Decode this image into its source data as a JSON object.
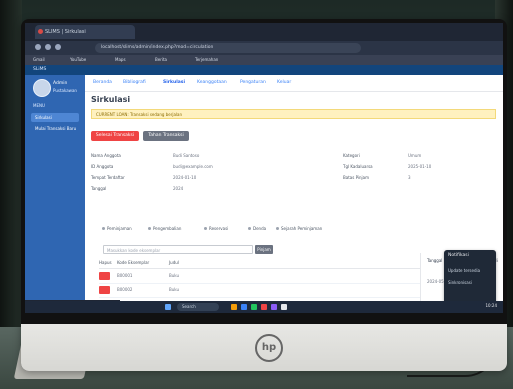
{
  "browser": {
    "tab_title": "SLIMS | Sirkulasi",
    "address": "localhost/slims/admin/index.php?mod=circulation",
    "bookmarks": [
      "Gmail",
      "YouTube",
      "Maps",
      "Berita",
      "Terjemahan"
    ]
  },
  "topbar": {
    "text": "SLiMS"
  },
  "sidebar": {
    "profile_name": "Admin",
    "profile_role": "Pustakawan",
    "section_label": "MENU",
    "items": [
      {
        "label": "Sirkulasi"
      },
      {
        "label": "Mulai Transaksi Baru"
      }
    ]
  },
  "menu": [
    "Beranda",
    "Bibliografi",
    "Sirkulasi",
    "Keanggotaan",
    "Pengaturan",
    "Keluar"
  ],
  "page": {
    "title": "Sirkulasi",
    "alert_text": "CURRENT LOAN: Transaksi sedang berjalan",
    "buttons": {
      "finish": "Selesai Transaksi",
      "hold": "Tahan Transaksi"
    }
  },
  "info": {
    "left_labels": [
      "Nama Anggota",
      "ID Anggota",
      "Tempat Terdaftar",
      "Tanggal"
    ],
    "left_values": [
      "Budi Santoso",
      "budi@example.com",
      "2024-01-10",
      "2024"
    ],
    "right_labels": [
      "Kategori",
      "Tgl Kadaluarsa",
      "Batas Pinjam"
    ],
    "right_values": [
      "Umum",
      "2025-01-10",
      "3"
    ]
  },
  "tabs": [
    "Peminjaman",
    "Pengembalian",
    "Reservasi",
    "Denda",
    "Sejarah Peminjaman"
  ],
  "search": {
    "placeholder": "Masukkan kode eksemplar",
    "button": "Pinjam"
  },
  "table": {
    "headers": [
      "Hapus",
      "Kode Eksemplar",
      "Judul"
    ],
    "rows": [
      {
        "code": "B00001",
        "title": "Buku"
      },
      {
        "code": "B00002",
        "title": "Buku"
      }
    ]
  },
  "right_panel": {
    "headers": [
      "Tanggal Pinjam",
      "Tanggal Kembali"
    ],
    "values": [
      "2024-05-01",
      "2024-05-08"
    ]
  },
  "notification": {
    "title": "Notifikasi",
    "items": [
      "Update tersedia",
      "Sinkronisasi"
    ]
  },
  "status_link": "localhost/slims/admin/index.php",
  "taskbar": {
    "search_label": "Search",
    "time": "10:24"
  }
}
